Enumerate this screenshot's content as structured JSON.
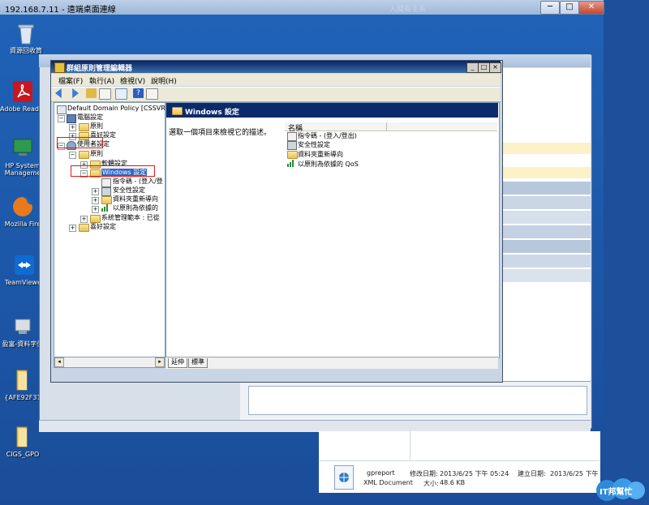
{
  "rdp": {
    "title": "192.168.7.11 - 遠端桌面連線",
    "ghost_text": "人間有主系",
    "controls": {
      "minimize": "─",
      "maximize": "□",
      "close": "✕"
    }
  },
  "desktop": {
    "icons": [
      {
        "label": "資源回收筒",
        "icon": "recycle-bin-icon"
      },
      {
        "label": "Adobe Read X",
        "icon": "adobe-reader-icon"
      },
      {
        "label": "HP System Manageme",
        "icon": "hp-system-icon"
      },
      {
        "label": "Mozilla Fire",
        "icon": "firefox-icon"
      },
      {
        "label": "TeamViewer",
        "icon": "teamviewer-icon"
      },
      {
        "label": "盈富-資料字值",
        "icon": "tool-icon"
      },
      {
        "label": "{AFE92F31",
        "icon": "folder-icon"
      },
      {
        "label": "CIGS_GPO",
        "icon": "folder-icon"
      }
    ]
  },
  "details_pane": {
    "file_name": "gpreport",
    "file_type": "XML Document",
    "modified_label": "修改日期:",
    "modified_value": "2013/6/25 下午 05:24",
    "size_label": "大小:",
    "size_value": "48.6 KB",
    "created_label": "建立日期:",
    "created_value": "2013/6/25 下午"
  },
  "gpo_editor": {
    "title": "群組原則管理編輯器",
    "menu": [
      "檔案(F)",
      "執行(A)",
      "檢視(V)",
      "說明(H)"
    ],
    "tree": {
      "root": "Default Domain Policy [CSSVRC",
      "computer_config": "電腦設定",
      "computer_policies": "原則",
      "computer_preferences": "喜好設定",
      "user_config": "使用者設定",
      "user_policies": "原則",
      "software_settings": "軟體設定",
      "windows_settings": "Windows 設定",
      "scripts": "指令碼 - (登入/登",
      "security": "安全性設定",
      "folder_redirection": "資料夾重新導向",
      "qos": "以原則為依據的",
      "admin_templates": "系統管理範本 : 已從",
      "user_preferences": "喜好設定"
    },
    "right_pane": {
      "header": "Windows 設定",
      "description": "選取一個項目來檢視它的描述。",
      "column_name": "名稱",
      "items": [
        {
          "label": "指令碼 - (登入/登出)",
          "icon": "script-icon"
        },
        {
          "label": "安全性設定",
          "icon": "security-icon"
        },
        {
          "label": "資料夾重新導向",
          "icon": "folder-icon"
        },
        {
          "label": "以原則為依據的 QoS",
          "icon": "qos-chart-icon"
        }
      ]
    },
    "tabs": [
      "延伸",
      "標準"
    ]
  },
  "logo": {
    "text": "IT邦幫忙"
  }
}
